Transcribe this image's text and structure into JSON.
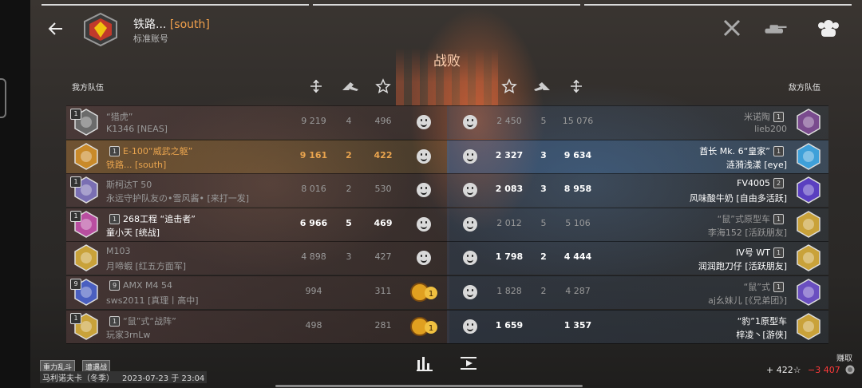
{
  "header": {
    "player_name": "铁路...",
    "clan": "[south]",
    "account_type": "标准账号",
    "result": "战败"
  },
  "labels": {
    "ally_team": "我方队伍",
    "enemy_team": "敌方队伍"
  },
  "icons": {
    "back": "back-arrow-icon",
    "sword": "crossed-swords-icon",
    "tank": "tank-icon",
    "team": "team-icon",
    "damage": "damage-icon",
    "kills": "kills-icon",
    "xp": "star-icon"
  },
  "allies": [
    {
      "tier": "1",
      "tank": "“猎虎”",
      "player": "K1346 [NEAS]",
      "damage": "9 219",
      "kills": "4",
      "xp": "496",
      "style": "dim"
    },
    {
      "tier": "1",
      "tank": "E-100“威武之躯”",
      "player": "铁路... [south]",
      "damage": "9 161",
      "kills": "2",
      "xp": "422",
      "style": "self"
    },
    {
      "tier": "1",
      "tank": "斯柯达T 50",
      "player": "永远守护队友の•雪风酱• [来打一发]",
      "damage": "8 016",
      "kills": "2",
      "xp": "530",
      "style": "dim"
    },
    {
      "tier": "1",
      "tank": "268工程 “追击者”",
      "player": "童小天 [统战]",
      "damage": "6 966",
      "kills": "5",
      "xp": "469",
      "style": "bold"
    },
    {
      "tier": "",
      "tank": "M103",
      "player": "月啼蝦 [红五方面军]",
      "damage": "4 898",
      "kills": "3",
      "xp": "427",
      "style": "dim"
    },
    {
      "tier": "9",
      "tank": "AMX M4 54",
      "player": "sws2011 [真理丨高中]",
      "damage": "994",
      "kills": "",
      "xp": "311",
      "style": "dim"
    },
    {
      "tier": "1",
      "tank": "“鼠”式“战阵”",
      "player": "玩家3rnLw",
      "damage": "498",
      "kills": "",
      "xp": "281",
      "style": "dim"
    }
  ],
  "enemies": [
    {
      "tier": "1",
      "tank": "米诺陶",
      "player": "lieb200",
      "damage": "15 076",
      "kills": "5",
      "xp": "2 450",
      "style": "dim"
    },
    {
      "tier": "1",
      "tank": "酋长 Mk. 6“皇家”",
      "player": "涟漪浅漾 [eye]",
      "damage": "9 634",
      "kills": "3",
      "xp": "2 327",
      "style": "bold"
    },
    {
      "tier": "2",
      "tank": "FV4005",
      "player": "风味酸牛奶 [自由多活跃]",
      "damage": "8 958",
      "kills": "3",
      "xp": "2 083",
      "style": "bold"
    },
    {
      "tier": "1",
      "tank": "“鼠”式原型车",
      "player": "李海152 [活跃朋友]",
      "damage": "5 106",
      "kills": "5",
      "xp": "2 012",
      "style": "dim"
    },
    {
      "tier": "1",
      "tank": "IV号 WT",
      "player": "润润跑刀仔 [活跃朋友]",
      "damage": "4 444",
      "kills": "2",
      "xp": "1 798",
      "style": "bold"
    },
    {
      "tier": "1",
      "tank": "“鼠”式",
      "player": "aj幺妹儿 [《兄弟团》]",
      "damage": "4 287",
      "kills": "2",
      "xp": "1 828",
      "style": "dim"
    },
    {
      "tier": "",
      "tank": "“豹”1原型车",
      "player": "梓凌丶[游侠]",
      "damage": "1 357",
      "kills": "",
      "xp": "1 659",
      "style": "bold"
    }
  ],
  "medal_count": "1",
  "footer": {
    "mode1": "重力乱斗",
    "mode2": "遭遇战",
    "map": "马利诺夫卡（冬季）",
    "datetime": "2023-07-23 于 23:04",
    "earned_label": "赚取",
    "xp_earned": "+ 422",
    "credits_earned": "−3 407"
  },
  "colors": {
    "self": "#e9a44e",
    "credits_negative": "#ff3a3a",
    "defeat_glow": "#ff7a3c"
  }
}
